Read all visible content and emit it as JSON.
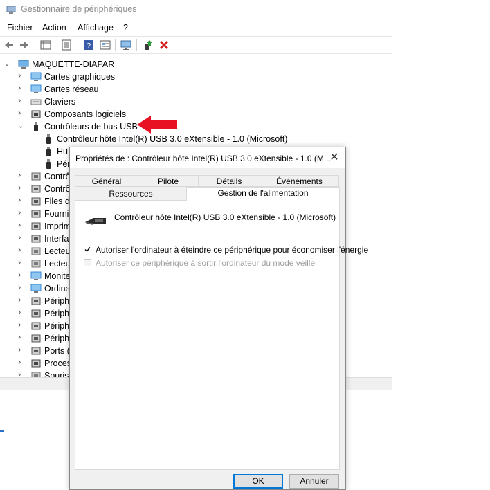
{
  "window": {
    "title": "Gestionnaire de périphériques",
    "icon": "device-manager-icon"
  },
  "menu": [
    "Fichier",
    "Action",
    "Affichage",
    "?"
  ],
  "toolbar": {
    "icons": [
      "back-arrow-icon",
      "forward-arrow-icon",
      "show-hide-tree-icon",
      "properties-icon",
      "help-icon",
      "view-icon",
      "scan-hardware-icon",
      "update-driver-icon",
      "uninstall-icon"
    ]
  },
  "tree": {
    "root": "MAQUETTE-DIAPAR",
    "items": [
      {
        "label": "Cartes graphiques",
        "icon": "display-adapter-icon",
        "expanded": false
      },
      {
        "label": "Cartes réseau",
        "icon": "network-adapter-icon",
        "expanded": false
      },
      {
        "label": "Claviers",
        "icon": "keyboard-icon",
        "expanded": false
      },
      {
        "label": "Composants logiciels",
        "icon": "software-component-icon",
        "expanded": false
      },
      {
        "label": "Contrôleurs de bus USB",
        "icon": "usb-icon",
        "expanded": true
      },
      {
        "label": "Contrôleur hôte Intel(R) USB 3.0 eXtensible - 1.0 (Microsoft)",
        "icon": "usb-plug-icon",
        "child": true
      },
      {
        "label": "Hu",
        "icon": "usb-plug-icon",
        "child": true
      },
      {
        "label": "Pér",
        "icon": "usb-plug-icon",
        "child": true
      },
      {
        "label": "Contrô",
        "icon": "audio-controller-icon",
        "expanded": false
      },
      {
        "label": "Contrô",
        "icon": "storage-controller-icon",
        "expanded": false
      },
      {
        "label": "Files d'",
        "icon": "print-queue-icon",
        "expanded": false
      },
      {
        "label": "Fournis",
        "icon": "print-provider-icon",
        "expanded": false
      },
      {
        "label": "Imprim",
        "icon": "printer-icon",
        "expanded": false
      },
      {
        "label": "Interfac",
        "icon": "hid-icon",
        "expanded": false
      },
      {
        "label": "Lecteu",
        "icon": "disk-drive-icon",
        "expanded": false
      },
      {
        "label": "Lecteu",
        "icon": "dvd-drive-icon",
        "expanded": false
      },
      {
        "label": "Monite",
        "icon": "monitor-icon",
        "expanded": false
      },
      {
        "label": "Ordina",
        "icon": "computer-icon",
        "expanded": false
      },
      {
        "label": "Périph",
        "icon": "software-device-icon",
        "expanded": false
      },
      {
        "label": "Périph",
        "icon": "security-device-icon",
        "expanded": false
      },
      {
        "label": "Périph",
        "icon": "system-device-icon",
        "expanded": false
      },
      {
        "label": "Périph",
        "icon": "memory-device-icon",
        "expanded": false
      },
      {
        "label": "Ports (",
        "icon": "port-icon",
        "expanded": false
      },
      {
        "label": "Proces",
        "icon": "processor-icon",
        "expanded": false
      },
      {
        "label": "Souris",
        "icon": "mouse-icon",
        "expanded": false
      }
    ]
  },
  "annotation": {
    "icon": "red-arrow-icon",
    "color": "#e81123"
  },
  "dialog": {
    "title": "Propriétés de : Contrôleur hôte Intel(R) USB 3.0 eXtensible - 1.0 (M...",
    "close": "✕",
    "tabs_row1": [
      "Général",
      "Pilote",
      "Détails",
      "Événements"
    ],
    "tabs_row2": [
      "Ressources",
      "Gestion de l'alimentation"
    ],
    "active_tab": "Gestion de l'alimentation",
    "device_name": "Contrôleur hôte Intel(R) USB 3.0 eXtensible - 1.0 (Microsoft)",
    "options": [
      {
        "label": "Autoriser l'ordinateur à éteindre ce périphérique pour économiser l'énergie",
        "checked": true,
        "enabled": true
      },
      {
        "label": "Autoriser ce périphérique à sortir l'ordinateur du mode veille",
        "checked": false,
        "enabled": false
      }
    ],
    "buttons": {
      "ok": "OK",
      "cancel": "Annuler"
    }
  },
  "colors": {
    "accent": "#0078d7",
    "arrow": "#e81123"
  }
}
